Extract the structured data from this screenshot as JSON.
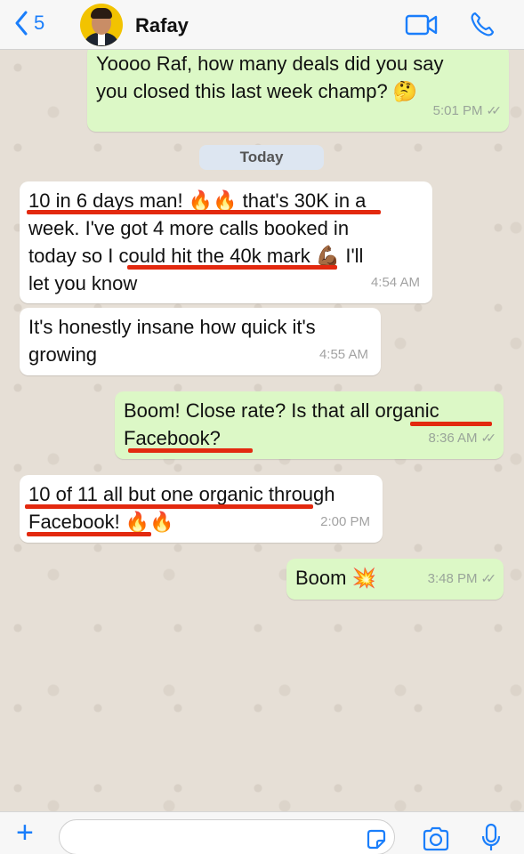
{
  "header": {
    "back_count": "5",
    "contact_name": "Rafay"
  },
  "messages": [
    {
      "direction": "out",
      "lines": [
        "Yoooo Raf, how many deals did you say",
        "you closed this last week champ? 🤔"
      ],
      "time": "5:01 PM"
    },
    {
      "direction": "in",
      "lines": [
        "10 in 6 days man! 🔥🔥 that's 30K in a",
        "week. I've got 4 more calls booked in",
        "today so I could hit the 40k mark 💪🏾 I'll",
        "let you know"
      ],
      "time": "4:54 AM"
    },
    {
      "direction": "in",
      "lines": [
        "It's honestly insane how quick it's",
        "growing"
      ],
      "time": "4:55 AM"
    },
    {
      "direction": "out",
      "lines": [
        "Boom!  Close rate? Is that all organic",
        "Facebook?"
      ],
      "time": "8:36 AM"
    },
    {
      "direction": "in",
      "lines": [
        "10 of 11 all but one organic through",
        "Facebook! 🔥🔥"
      ],
      "time": "2:00 PM"
    },
    {
      "direction": "out",
      "lines": [
        "Boom 💥"
      ],
      "time": "3:48 PM"
    }
  ],
  "date_divider": "Today",
  "input": {
    "placeholder": ""
  },
  "colors": {
    "accent": "#1a7efb",
    "outgoing": "#dcf8c6",
    "incoming": "#ffffff",
    "highlight": "#e3290f"
  },
  "icons": [
    "back-chevron-icon",
    "video-call-icon",
    "phone-call-icon",
    "read-ticks-icon",
    "plus-icon",
    "sticker-icon",
    "camera-icon",
    "microphone-icon"
  ]
}
